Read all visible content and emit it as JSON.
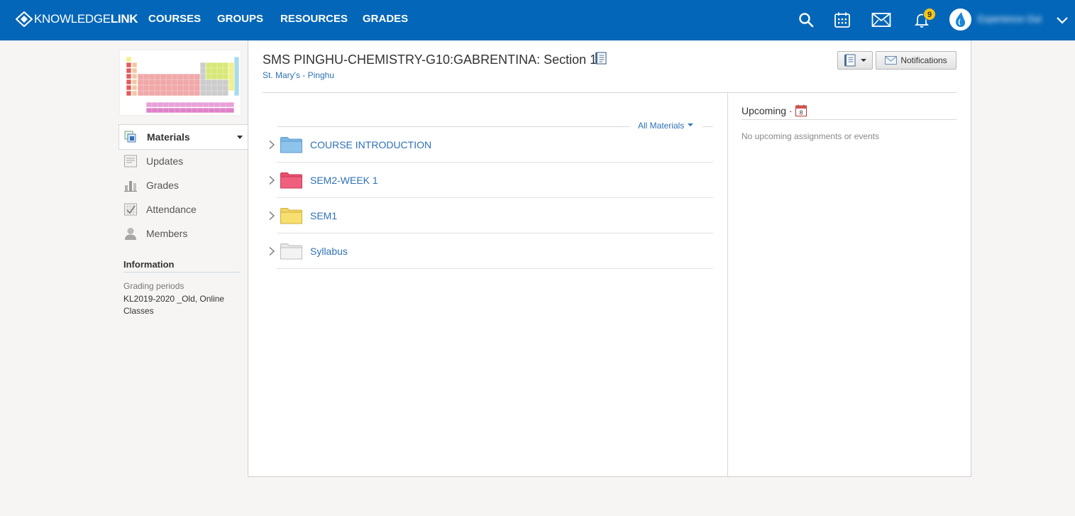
{
  "colors": {
    "topbar": "#0366b8",
    "link": "#2e71b6",
    "badge": "#f5c518",
    "folder_blue": "#7fb9e6",
    "folder_red": "#e8506e",
    "folder_yellow": "#f2d562",
    "folder_white": "#efefef"
  },
  "header": {
    "logo_light": "KNOWLEDGE",
    "logo_bold": "LINK",
    "nav": [
      "COURSES",
      "GROUPS",
      "RESOURCES",
      "GRADES"
    ],
    "icons": [
      "search-icon",
      "calendar-icon",
      "mail-icon",
      "bell-icon"
    ],
    "notification_count": "9",
    "user_name": "Experience Out"
  },
  "sidebar": {
    "active": {
      "label": "Materials",
      "icon": "materials-icon"
    },
    "items": [
      {
        "label": "Updates",
        "icon": "updates-icon"
      },
      {
        "label": "Grades",
        "icon": "grades-icon"
      },
      {
        "label": "Attendance",
        "icon": "attendance-icon"
      },
      {
        "label": "Members",
        "icon": "members-icon"
      }
    ],
    "information": {
      "title": "Information",
      "grading_label": "Grading periods",
      "grading_value": "KL2019-2020 _Old, Online Classes"
    }
  },
  "course": {
    "title": "SMS PINGHU-CHEMISTRY-G10:GABRENTINA: Section 1",
    "school": "St. Mary's - Pinghu",
    "notifications_button": "Notifications"
  },
  "materials": {
    "filter_label": "All Materials",
    "folders": [
      {
        "name": "COURSE INTRODUCTION",
        "color": "#7fb9e6"
      },
      {
        "name": "SEM2-WEEK 1",
        "color": "#e8506e"
      },
      {
        "name": "SEM1",
        "color": "#f2d562"
      },
      {
        "name": "Syllabus",
        "color": "#efefef"
      }
    ]
  },
  "upcoming": {
    "title": "Upcoming ·",
    "calendar_day": "8",
    "empty_text": "No upcoming assignments or events"
  }
}
